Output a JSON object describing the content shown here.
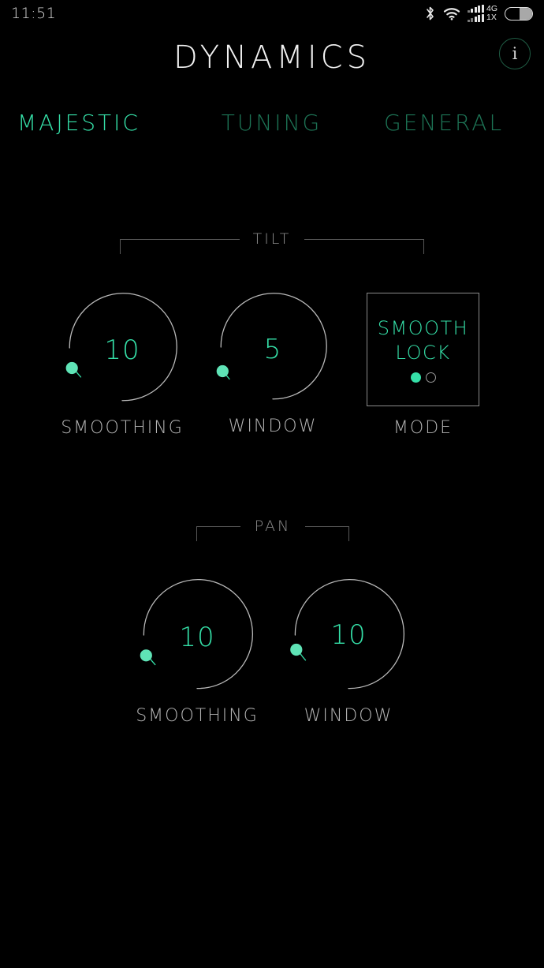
{
  "statusbar": {
    "time": "11:51",
    "bluetooth_icon": "bluetooth-icon",
    "wifi_icon": "wifi-icon",
    "network_primary": "4G",
    "network_secondary": "1X",
    "battery_icon": "battery-icon",
    "battery_level_pct": 48
  },
  "header": {
    "title": "DYNAMICS",
    "info_label": "i"
  },
  "tabs": [
    {
      "label": "MAJESTIC",
      "active": true
    },
    {
      "label": "TUNING",
      "active": false
    },
    {
      "label": "GENERAL",
      "active": false
    }
  ],
  "colors": {
    "accent": "#35e0a8",
    "accent_dim": "#1d7355",
    "background": "#000000",
    "arc": "#b9b9b9",
    "label": "#b4b4b4",
    "group_line": "#585858"
  },
  "groups": [
    {
      "title": "TILT",
      "controls": [
        {
          "type": "knob",
          "label": "SMOOTHING",
          "value": "10"
        },
        {
          "type": "knob",
          "label": "WINDOW",
          "value": "5"
        },
        {
          "type": "mode",
          "label": "MODE",
          "line1": "SMOOTH",
          "line2": "LOCK",
          "pages": [
            {
              "selected": true
            },
            {
              "selected": false
            }
          ]
        }
      ]
    },
    {
      "title": "PAN",
      "controls": [
        {
          "type": "knob",
          "label": "SMOOTHING",
          "value": "10"
        },
        {
          "type": "knob",
          "label": "WINDOW",
          "value": "10"
        }
      ]
    }
  ]
}
